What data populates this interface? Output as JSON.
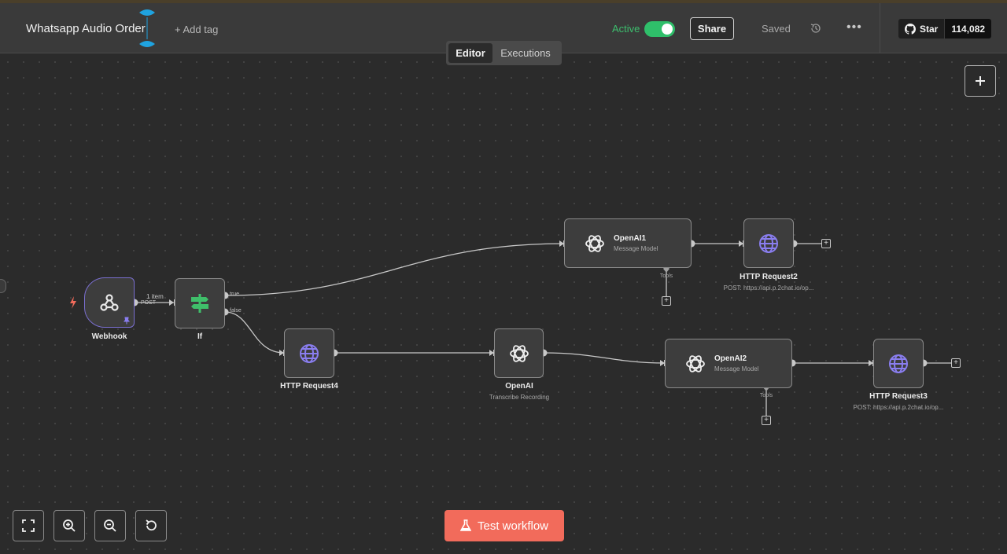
{
  "header": {
    "title": "Whatsapp Audio Order",
    "add_tag": "+ Add tag",
    "active_label": "Active",
    "share": "Share",
    "saved": "Saved",
    "github_star": "Star",
    "github_count": "114,082"
  },
  "tabs": [
    {
      "label": "Editor"
    },
    {
      "label": "Executions"
    }
  ],
  "nodes": {
    "webhook": {
      "label": "Webhook"
    },
    "if": {
      "label": "If"
    },
    "openai1": {
      "title": "OpenAI1",
      "subtitle": "Message Model"
    },
    "http2": {
      "label": "HTTP Request2",
      "sub": "POST: https://api.p.2chat.io/op..."
    },
    "http4": {
      "label": "HTTP Request4"
    },
    "openai": {
      "label": "OpenAI",
      "sub": "Transcribe Recording"
    },
    "openai2": {
      "title": "OpenAI2",
      "subtitle": "Message Model"
    },
    "http3": {
      "label": "HTTP Request3",
      "sub": "POST: https://api.p.2chat.io/op..."
    }
  },
  "edges": {
    "webhook_items": "1 item",
    "webhook_method": "POST",
    "if_true": "true",
    "if_false": "false",
    "tools": "Tools"
  },
  "test_button": "Test workflow",
  "colors": {
    "accent_active": "#2fbf6a",
    "test_button": "#f26b5b",
    "http_icon": "#8a7ef0",
    "if_icon": "#3fbf6a",
    "webhook_border": "#7a6fd0"
  }
}
